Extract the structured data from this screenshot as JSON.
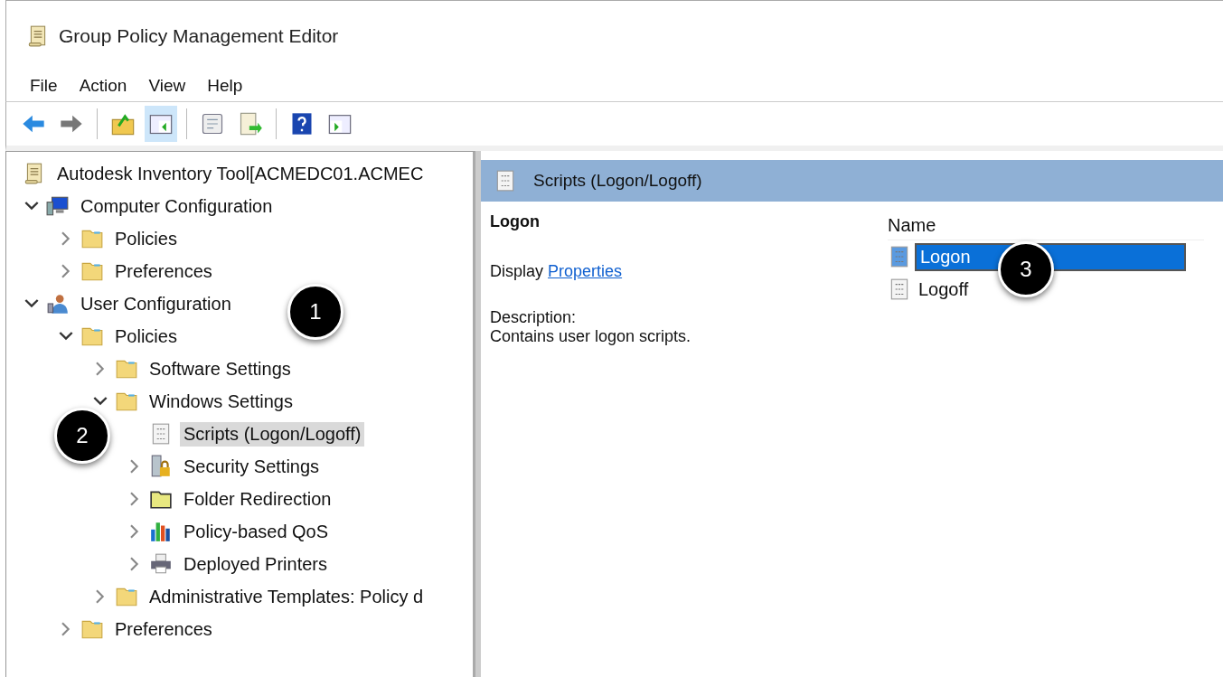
{
  "window": {
    "title": "Group Policy Management Editor"
  },
  "menu": [
    "File",
    "Action",
    "View",
    "Help"
  ],
  "toolbar": [
    [
      {
        "kind": "back",
        "selected": false
      },
      {
        "kind": "forward",
        "selected": false
      }
    ],
    [
      {
        "kind": "up",
        "selected": false
      },
      {
        "kind": "tree",
        "selected": true
      }
    ],
    [
      {
        "kind": "properties",
        "selected": false
      },
      {
        "kind": "export",
        "selected": false
      }
    ],
    [
      {
        "kind": "help",
        "selected": false
      },
      {
        "kind": "action-pane",
        "selected": false
      }
    ]
  ],
  "tree": [
    {
      "label": "Autodesk Inventory Tool[ACMEDC01.ACMEC",
      "kind": "scroll",
      "selected": false,
      "children": [
        {
          "label": "Computer Configuration",
          "kind": "computer",
          "expanded": true,
          "selected": false,
          "children": [
            {
              "label": "Policies",
              "kind": "folder",
              "expanded": false,
              "selected": false
            },
            {
              "label": "Preferences",
              "kind": "folder",
              "expanded": false,
              "selected": false
            }
          ]
        },
        {
          "label": "User Configuration",
          "kind": "user",
          "expanded": true,
          "selected": false,
          "children": [
            {
              "label": "Policies",
              "kind": "folder",
              "expanded": true,
              "selected": false,
              "children": [
                {
                  "label": "Software Settings",
                  "kind": "folder",
                  "expanded": false,
                  "selected": false
                },
                {
                  "label": "Windows Settings",
                  "kind": "folder",
                  "expanded": true,
                  "selected": false,
                  "children": [
                    {
                      "label": "Scripts (Logon/Logoff)",
                      "kind": "script",
                      "selected": true
                    },
                    {
                      "label": "Security Settings",
                      "kind": "security",
                      "expanded": false,
                      "selected": false
                    },
                    {
                      "label": "Folder Redirection",
                      "kind": "redirect",
                      "expanded": false,
                      "selected": false
                    },
                    {
                      "label": "Policy-based QoS",
                      "kind": "chart",
                      "expanded": false,
                      "selected": false
                    },
                    {
                      "label": "Deployed Printers",
                      "kind": "printer",
                      "expanded": false,
                      "selected": false
                    }
                  ]
                },
                {
                  "label": "Administrative Templates: Policy d",
                  "kind": "folder",
                  "expanded": false,
                  "selected": false
                }
              ]
            },
            {
              "label": "Preferences",
              "kind": "folder",
              "expanded": false,
              "selected": false
            }
          ]
        }
      ]
    }
  ],
  "details": {
    "header": "Scripts (Logon/Logoff)",
    "heading": "Logon",
    "display_label": "Display",
    "link": "Properties ",
    "description_label": "Description:",
    "description": "Contains user logon scripts."
  },
  "list": {
    "column": "Name",
    "items": [
      {
        "label": "Logon",
        "selected": true
      },
      {
        "label": "Logoff",
        "selected": false
      }
    ]
  },
  "callouts": [
    "1",
    "2",
    "3"
  ]
}
